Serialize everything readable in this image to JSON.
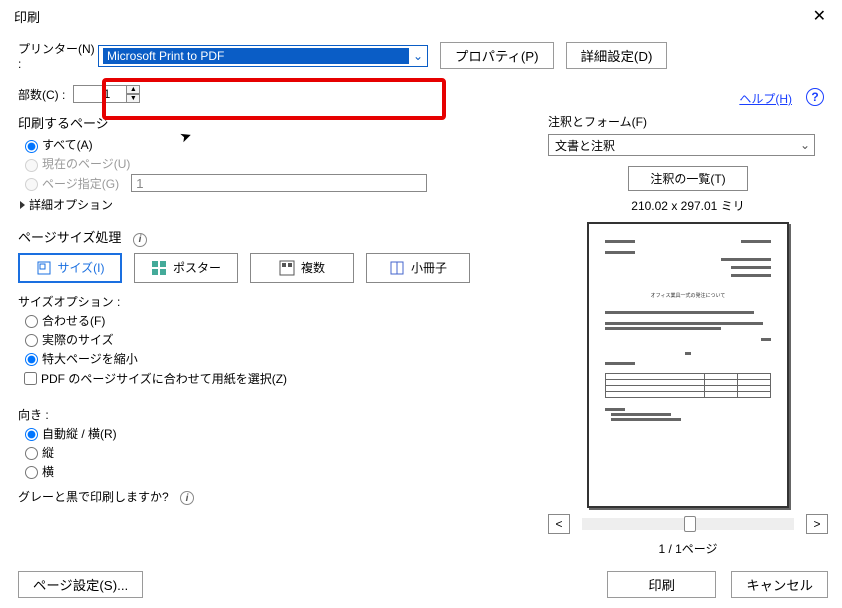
{
  "window": {
    "title": "印刷"
  },
  "top": {
    "printer_label": "プリンター(N) :",
    "printer_value": "Microsoft Print to PDF",
    "properties_btn": "プロパティ(P)",
    "advanced_btn": "詳細設定(D)",
    "help_link": "ヘルプ(H)"
  },
  "copies": {
    "label": "部数(C) :",
    "value": "1"
  },
  "pages": {
    "title": "印刷するページ",
    "all": "すべて(A)",
    "current": "現在のページ(U)",
    "range": "ページ指定(G)",
    "range_value": "1",
    "advanced": "詳細オプション"
  },
  "sizehandling": {
    "title": "ページサイズ処理",
    "tabs": {
      "size": "サイズ(I)",
      "poster": "ポスター",
      "multiple": "複数",
      "booklet": "小冊子"
    },
    "size_options_title": "サイズオプション :",
    "fit": "合わせる(F)",
    "actual": "実際のサイズ",
    "shrink": "特大ページを縮小",
    "select_paper": "PDF のページサイズに合わせて用紙を選択(Z)"
  },
  "orientation": {
    "title": "向き :",
    "auto": "自動縦 / 横(R)",
    "portrait": "縦",
    "landscape": "横"
  },
  "grayscale_label": "グレーと黒で印刷しますか?",
  "right": {
    "comments_title": "注釈とフォーム(F)",
    "comments_value": "文書と注釈",
    "list_btn": "注釈の一覧(T)",
    "paper_size": "210.02 x 297.01 ミリ",
    "page_count": "1 / 1ページ"
  },
  "bottom": {
    "page_setup": "ページ設定(S)...",
    "print": "印刷",
    "cancel": "キャンセル"
  }
}
